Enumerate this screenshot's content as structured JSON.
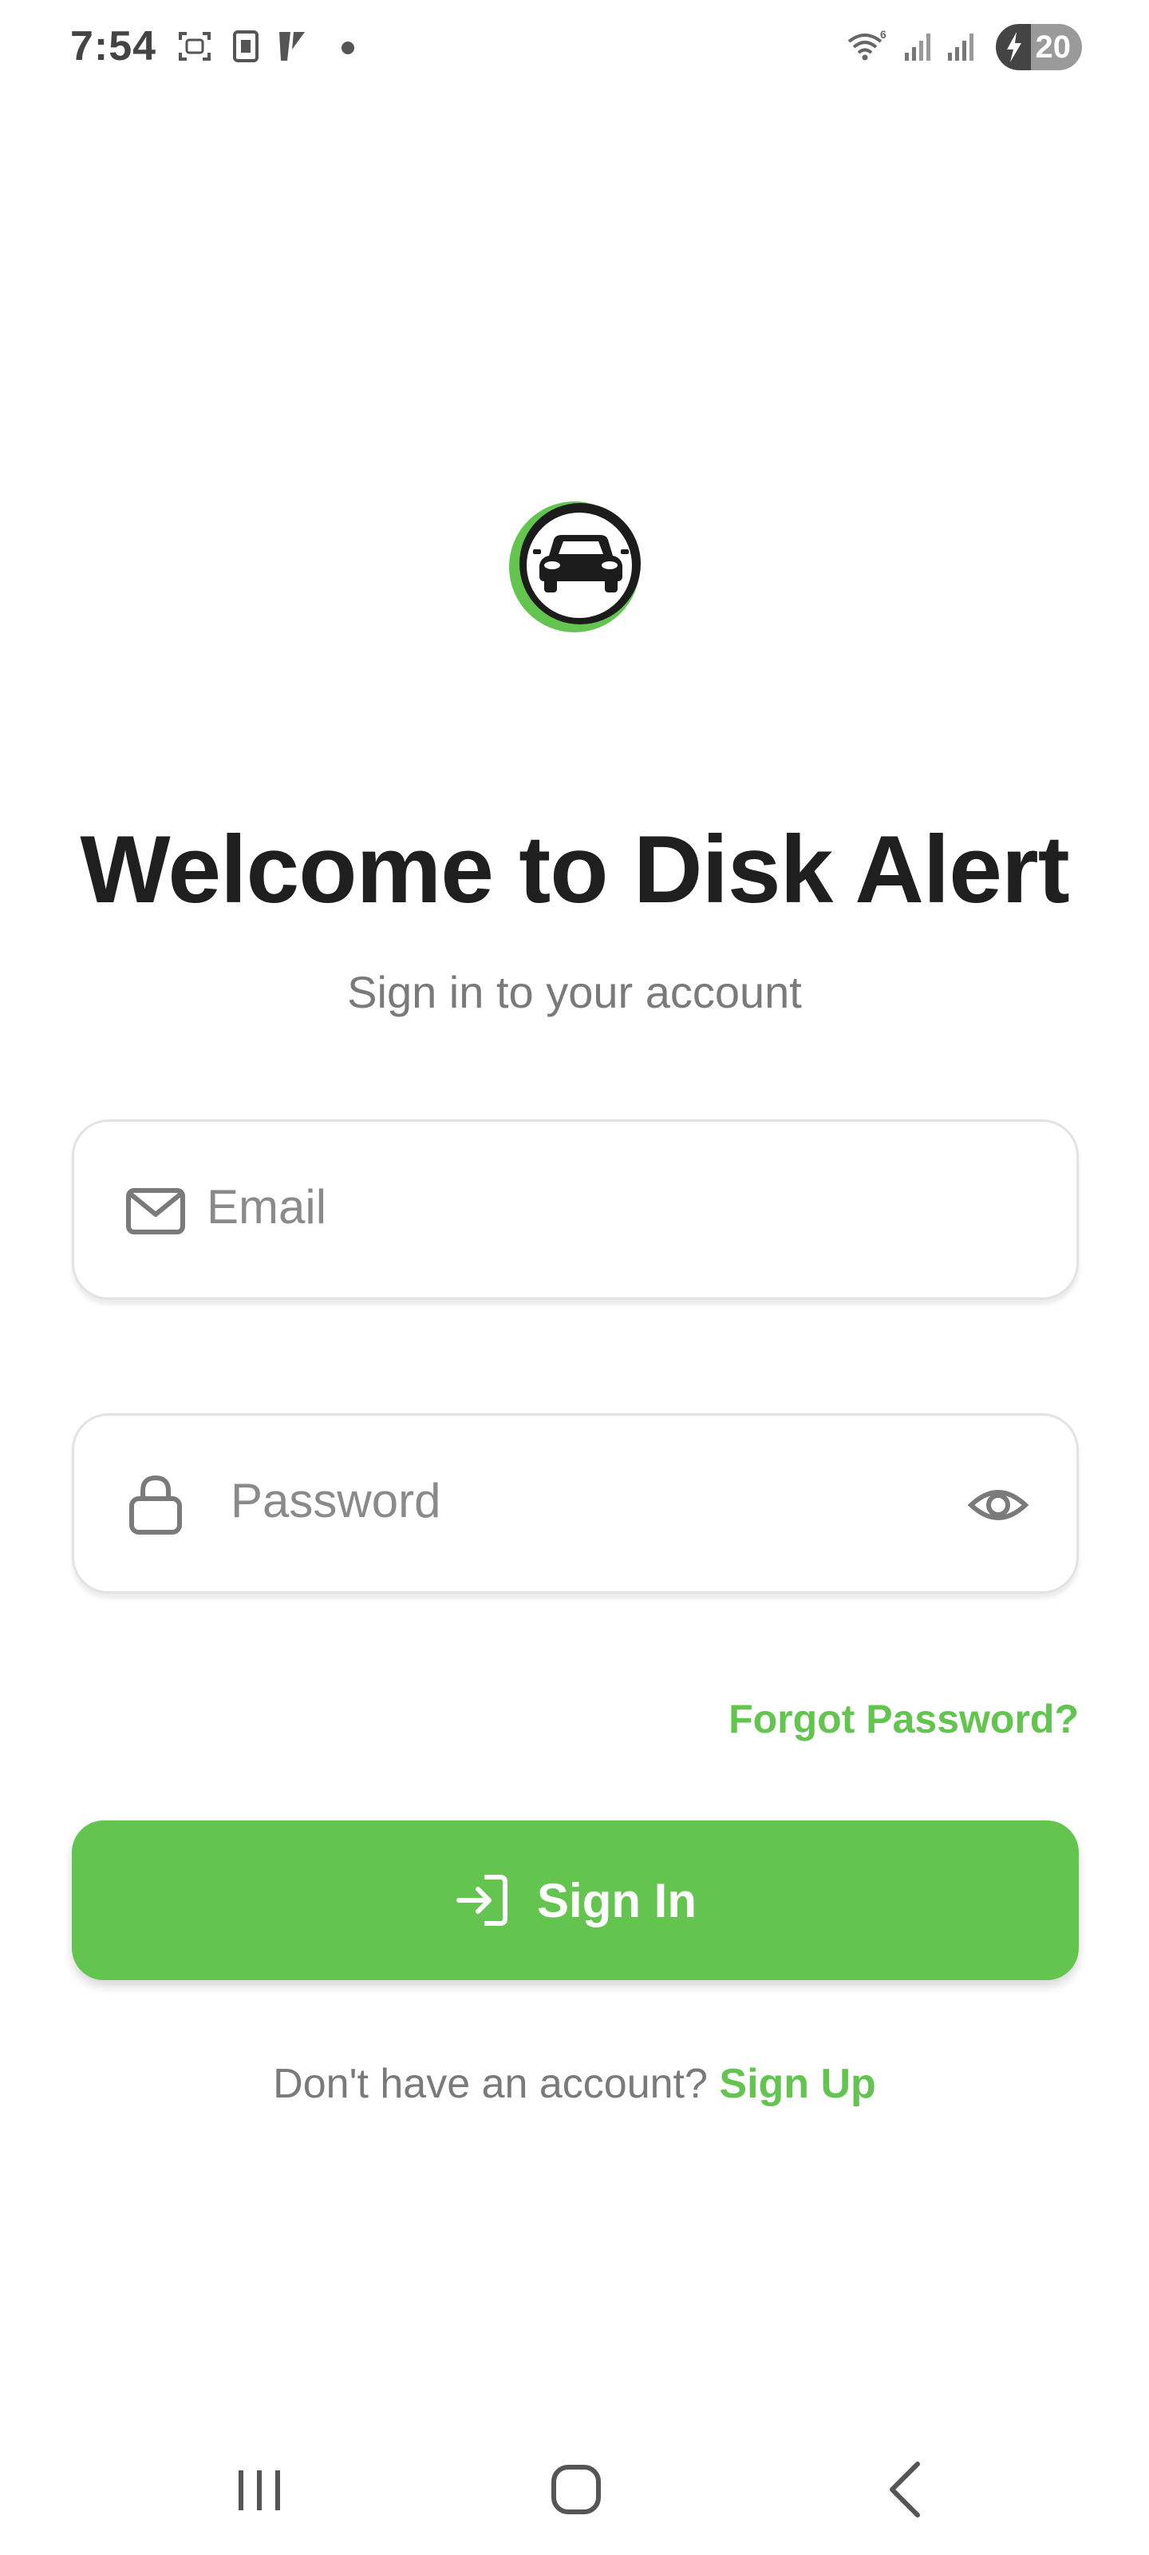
{
  "status_bar": {
    "time": "7:54",
    "battery": "20",
    "icons": [
      "screenshot-icon",
      "sim-icon",
      "app-y-icon",
      "wifi-6-icon",
      "signal-icon",
      "signal-icon"
    ]
  },
  "app": {
    "logo": "car-logo",
    "title": "Welcome to Disk Alert",
    "subtitle": "Sign in to your account"
  },
  "form": {
    "email_placeholder": "Email",
    "password_placeholder": "Password",
    "forgot_password": "Forgot Password?",
    "signin_label": "Sign In",
    "signup_prompt": "Don't have an account?",
    "signup_link": "Sign Up"
  },
  "colors": {
    "accent": "#63c550",
    "text_dark": "#1f1f1f",
    "text_muted": "#7a7a7a"
  },
  "nav_bar": {
    "buttons": [
      "recents",
      "home",
      "back"
    ]
  }
}
